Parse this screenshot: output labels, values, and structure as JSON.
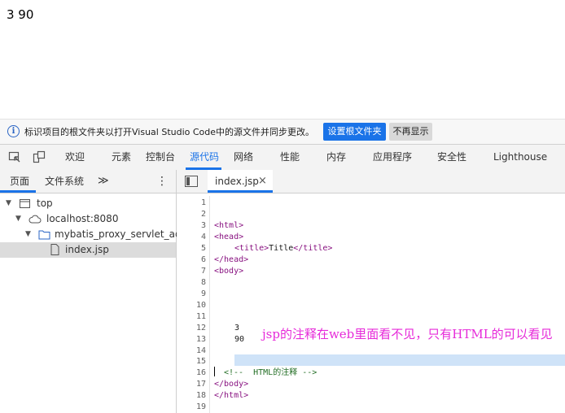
{
  "page": {
    "output_text": "3 90"
  },
  "infobar": {
    "message": "标识项目的根文件夹以打开Visual Studio Code中的源文件并同步更改。",
    "set_root_button": "设置根文件夹",
    "dont_show_button": "不再显示"
  },
  "toolbar": {
    "tabs": [
      "欢迎",
      "元素",
      "控制台",
      "源代码",
      "网络",
      "性能",
      "内存",
      "应用程序",
      "安全性",
      "Lighthouse"
    ],
    "active_tab": "源代码"
  },
  "navigator": {
    "tabs": [
      "页面",
      "文件系统"
    ],
    "more": "≫",
    "menu": "⋮",
    "tree": [
      "top",
      "localhost:8080",
      "mybatis_proxy_servlet_addStu",
      "index.jsp"
    ]
  },
  "editor": {
    "file_tab": "index.jsp",
    "close": "×",
    "line_numbers": [
      "1",
      "2",
      "3",
      "4",
      "5",
      "6",
      "7",
      "8",
      "9",
      "10",
      "11",
      "12",
      "13",
      "14",
      "15",
      "16",
      "17",
      "18",
      "19"
    ],
    "lines": {
      "l3": "<html>",
      "l4": "<head>",
      "l5_open": "<title>",
      "l5_text": "Title",
      "l5_close": "</title>",
      "l6": "</head>",
      "l7": "<body>",
      "l12": "3",
      "l13": "90",
      "l16": "<!--  HTML的注释 -->",
      "l17": "</body>",
      "l18": "</html>"
    }
  },
  "annotation": {
    "text": "jsp的注释在web里面看不见，只有HTML的可以看见",
    "color": "#e62ad9"
  },
  "colors": {
    "accent": "#1a73e8",
    "tag": "#881280",
    "comment": "#236e25"
  }
}
